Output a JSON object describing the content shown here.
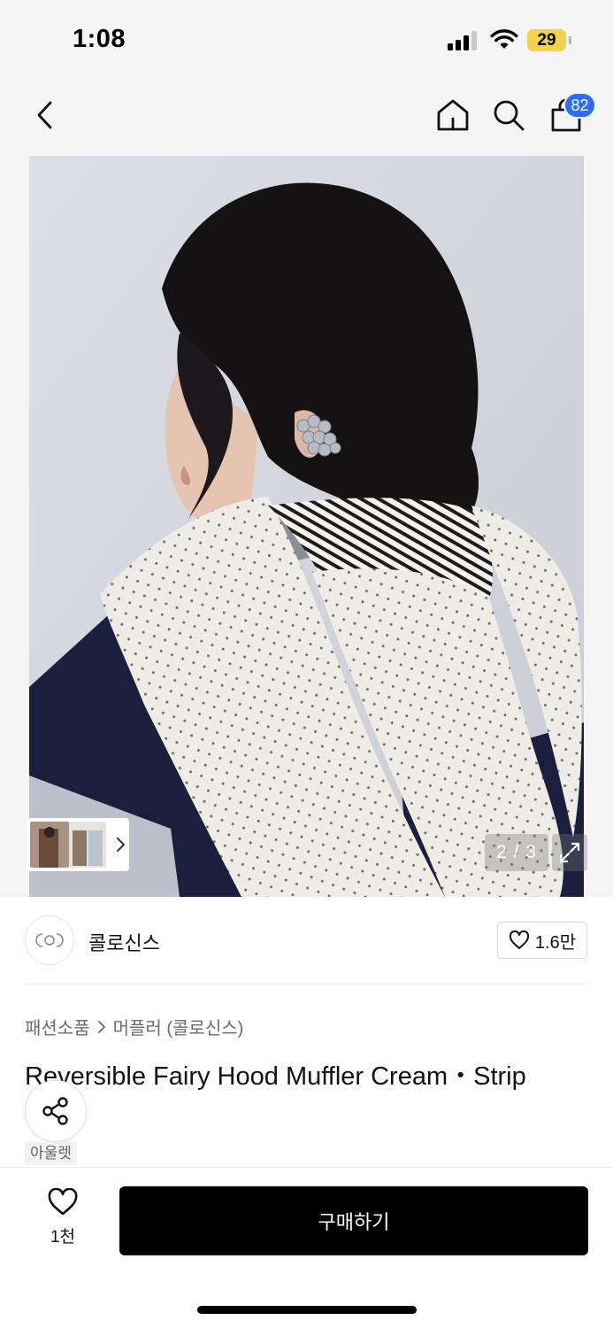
{
  "status_bar": {
    "time": "1:08",
    "battery": "29",
    "icons": [
      "signal-icon",
      "wifi-icon",
      "battery-icon"
    ]
  },
  "nav": {
    "back_icon": "chevron-left-icon",
    "home_icon": "home-icon",
    "search_icon": "search-icon",
    "cart_icon": "shopping-bag-icon",
    "cart_badge": "82",
    "badge_color": "#2e6df6"
  },
  "gallery": {
    "counter": "2 / 3",
    "expand_icon": "expand-icon",
    "thumbs_chevron_icon": "chevron-right-icon"
  },
  "brand": {
    "name": "콜로신스",
    "like_count": "1.6만",
    "like_icon": "heart-outline-icon"
  },
  "breadcrumb": {
    "category": "패션소품",
    "separator_icon": "chevron-right-icon",
    "subcategory": "머플러 (콜로신스)"
  },
  "product": {
    "title": "Reversible Fairy Hood Muffler Cream・Strip",
    "outlet_tag": "아울렛"
  },
  "share": {
    "icon": "share-icon"
  },
  "bottom_bar": {
    "like_count": "1천",
    "like_icon": "heart-outline-icon",
    "buy_label": "구매하기",
    "buy_color": "#000000"
  }
}
